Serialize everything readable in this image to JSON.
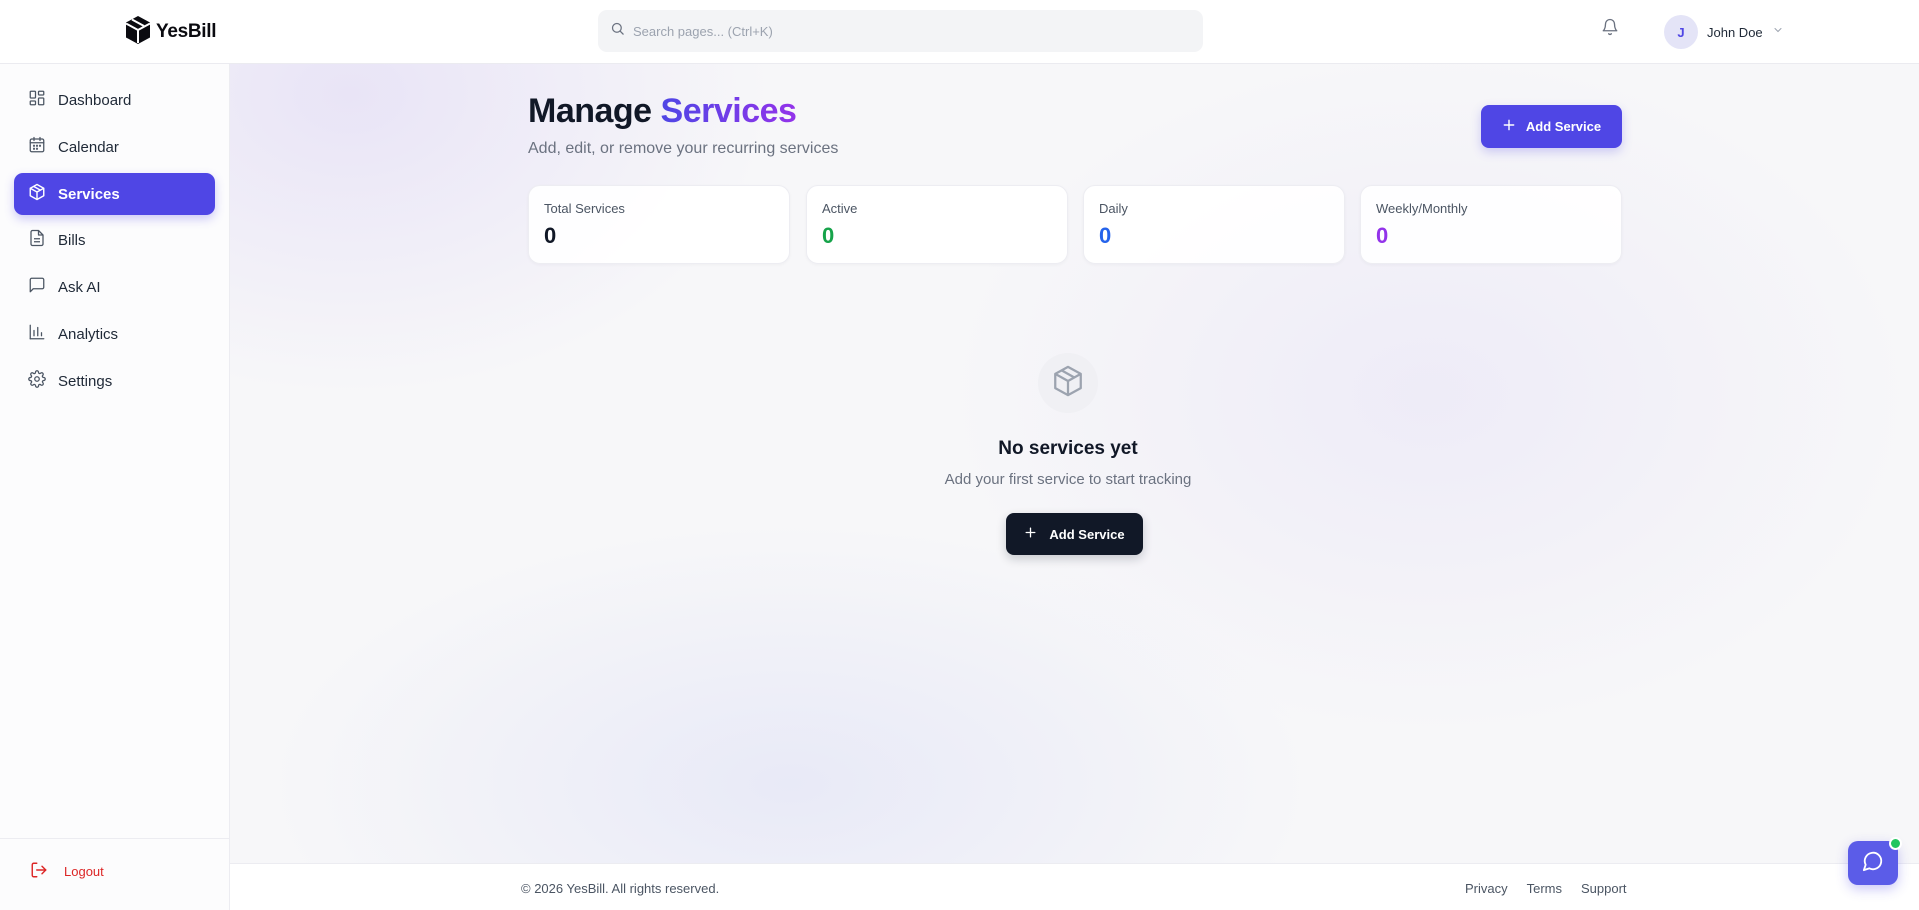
{
  "header": {
    "brand": "YesBill",
    "search": {
      "placeholder": "Search pages... (Ctrl+K)",
      "value": ""
    },
    "user": {
      "initial": "J",
      "name": "John Doe"
    }
  },
  "sidebar": {
    "items": [
      {
        "label": "Dashboard",
        "icon": "dashboard-icon",
        "active": false
      },
      {
        "label": "Calendar",
        "icon": "calendar-icon",
        "active": false
      },
      {
        "label": "Services",
        "icon": "package-icon",
        "active": true
      },
      {
        "label": "Bills",
        "icon": "document-icon",
        "active": false
      },
      {
        "label": "Ask AI",
        "icon": "message-icon",
        "active": false
      },
      {
        "label": "Analytics",
        "icon": "bar-chart-icon",
        "active": false
      },
      {
        "label": "Settings",
        "icon": "gear-icon",
        "active": false
      }
    ],
    "logout_label": "Logout"
  },
  "main": {
    "title_plain": "Manage",
    "title_accent": "Services",
    "subtitle": "Add, edit, or remove your recurring services",
    "add_button_label": "Add Service",
    "stats": [
      {
        "label": "Total Services",
        "value": "0",
        "color": "#111827"
      },
      {
        "label": "Active",
        "value": "0",
        "color": "#16a34a"
      },
      {
        "label": "Daily",
        "value": "0",
        "color": "#2563eb"
      },
      {
        "label": "Weekly/Monthly",
        "value": "0",
        "color": "#9333ea"
      }
    ],
    "empty_state": {
      "title": "No services yet",
      "subtitle": "Add your first service to start tracking",
      "button_label": "Add Service"
    }
  },
  "footer": {
    "copyright": "© 2026 YesBill. All rights reserved.",
    "links": [
      "Privacy",
      "Terms",
      "Support"
    ]
  },
  "colors": {
    "accent": "#4f46e5",
    "accent_gradient_end": "#9333ea",
    "dark_button": "#111827",
    "logout": "#dc2626",
    "online_indicator": "#22c55e"
  }
}
